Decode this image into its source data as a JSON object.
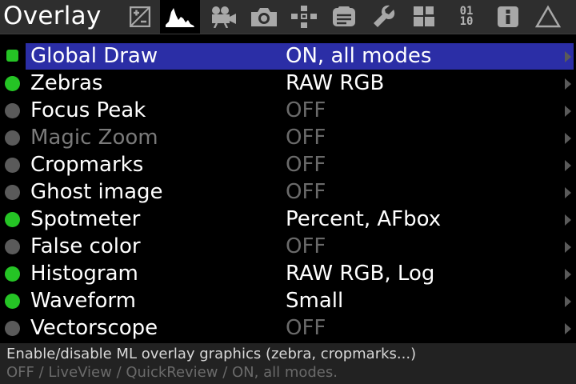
{
  "header": {
    "title": "Overlay",
    "tabs": [
      {
        "icon": "exposure-plus-minus-icon"
      },
      {
        "icon": "histogram-icon",
        "active": true
      },
      {
        "icon": "movie-camera-icon"
      },
      {
        "icon": "photo-camera-icon"
      },
      {
        "icon": "focus-icon"
      },
      {
        "icon": "display-icon"
      },
      {
        "icon": "wrench-icon"
      },
      {
        "icon": "modules-icon"
      },
      {
        "icon": "debug-binary-icon",
        "text_top": "01",
        "text_bottom": "10"
      },
      {
        "icon": "info-icon"
      },
      {
        "icon": "delta-triangle-icon"
      }
    ]
  },
  "menu": {
    "items": [
      {
        "label": "Global Draw",
        "value": "ON, all modes",
        "indicator": "square-green",
        "selected": true,
        "dim_label": false,
        "dim_value": false
      },
      {
        "label": "Zebras",
        "value": "RAW RGB",
        "indicator": "green",
        "selected": false,
        "dim_label": false,
        "dim_value": false
      },
      {
        "label": "Focus Peak",
        "value": "OFF",
        "indicator": "gray",
        "selected": false,
        "dim_label": false,
        "dim_value": true
      },
      {
        "label": "Magic Zoom",
        "value": "OFF",
        "indicator": "gray",
        "selected": false,
        "dim_label": true,
        "dim_value": true
      },
      {
        "label": "Cropmarks",
        "value": "OFF",
        "indicator": "gray",
        "selected": false,
        "dim_label": false,
        "dim_value": true
      },
      {
        "label": "Ghost image",
        "value": "OFF",
        "indicator": "gray",
        "selected": false,
        "dim_label": false,
        "dim_value": true
      },
      {
        "label": "Spotmeter",
        "value": "Percent, AFbox",
        "indicator": "green",
        "selected": false,
        "dim_label": false,
        "dim_value": false
      },
      {
        "label": "False color",
        "value": "OFF",
        "indicator": "gray",
        "selected": false,
        "dim_label": false,
        "dim_value": true
      },
      {
        "label": "Histogram",
        "value": "RAW RGB, Log",
        "indicator": "green",
        "selected": false,
        "dim_label": false,
        "dim_value": false
      },
      {
        "label": "Waveform",
        "value": "Small",
        "indicator": "green",
        "selected": false,
        "dim_label": false,
        "dim_value": false
      },
      {
        "label": "Vectorscope",
        "value": "OFF",
        "indicator": "gray",
        "selected": false,
        "dim_label": false,
        "dim_value": true
      }
    ]
  },
  "footer": {
    "help_line_1": "Enable/disable ML overlay graphics (zebra, cropmarks...)",
    "help_line_2": "OFF / LiveView / QuickReview / ON, all modes."
  },
  "colors": {
    "selection": "#2b2ea6",
    "indicator_on": "#25c425",
    "indicator_off": "#5a5a5a",
    "topbar_bg": "#2e2e2e",
    "footer_bg": "#222222"
  }
}
